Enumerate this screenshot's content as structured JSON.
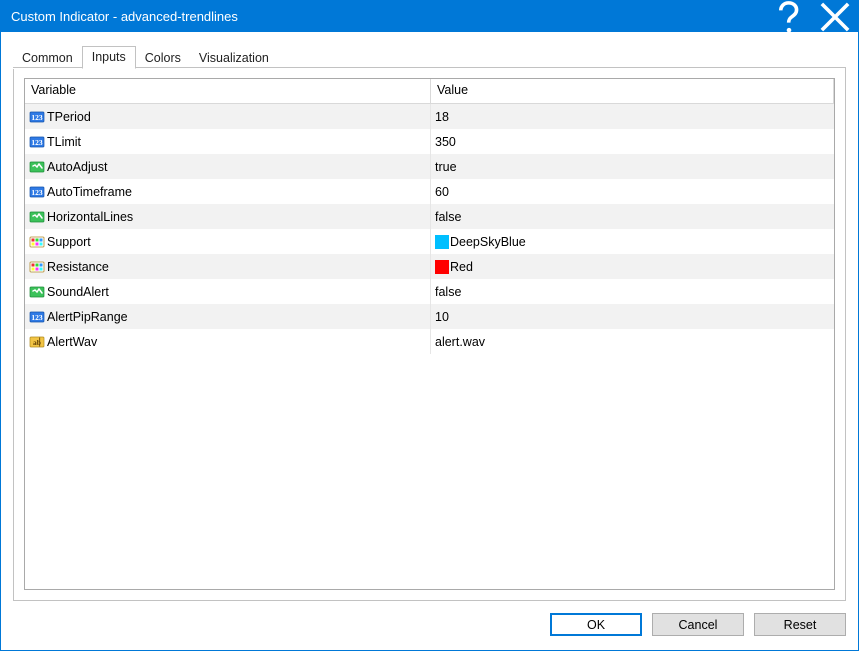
{
  "window": {
    "title": "Custom Indicator - advanced-trendlines"
  },
  "tabs": {
    "items": [
      {
        "label": "Common",
        "active": false
      },
      {
        "label": "Inputs",
        "active": true
      },
      {
        "label": "Colors",
        "active": false
      },
      {
        "label": "Visualization",
        "active": false
      }
    ]
  },
  "grid": {
    "header_variable": "Variable",
    "header_value": "Value",
    "rows": [
      {
        "icon": "int",
        "name": "TPeriod",
        "value": "18",
        "alt": true
      },
      {
        "icon": "int",
        "name": "TLimit",
        "value": "350",
        "alt": false
      },
      {
        "icon": "bool",
        "name": "AutoAdjust",
        "value": "true",
        "alt": true
      },
      {
        "icon": "int",
        "name": "AutoTimeframe",
        "value": "60",
        "alt": false
      },
      {
        "icon": "bool",
        "name": "HorizontalLines",
        "value": "false",
        "alt": true
      },
      {
        "icon": "color",
        "name": "Support",
        "value": "DeepSkyBlue",
        "alt": false,
        "swatch": "#00bfff"
      },
      {
        "icon": "color",
        "name": "Resistance",
        "value": "Red",
        "alt": true,
        "swatch": "#ff0000"
      },
      {
        "icon": "bool",
        "name": "SoundAlert",
        "value": "false",
        "alt": false
      },
      {
        "icon": "int",
        "name": "AlertPipRange",
        "value": "10",
        "alt": true
      },
      {
        "icon": "string",
        "name": "AlertWav",
        "value": "alert.wav",
        "alt": false
      }
    ]
  },
  "buttons": {
    "ok": "OK",
    "cancel": "Cancel",
    "reset": "Reset"
  }
}
